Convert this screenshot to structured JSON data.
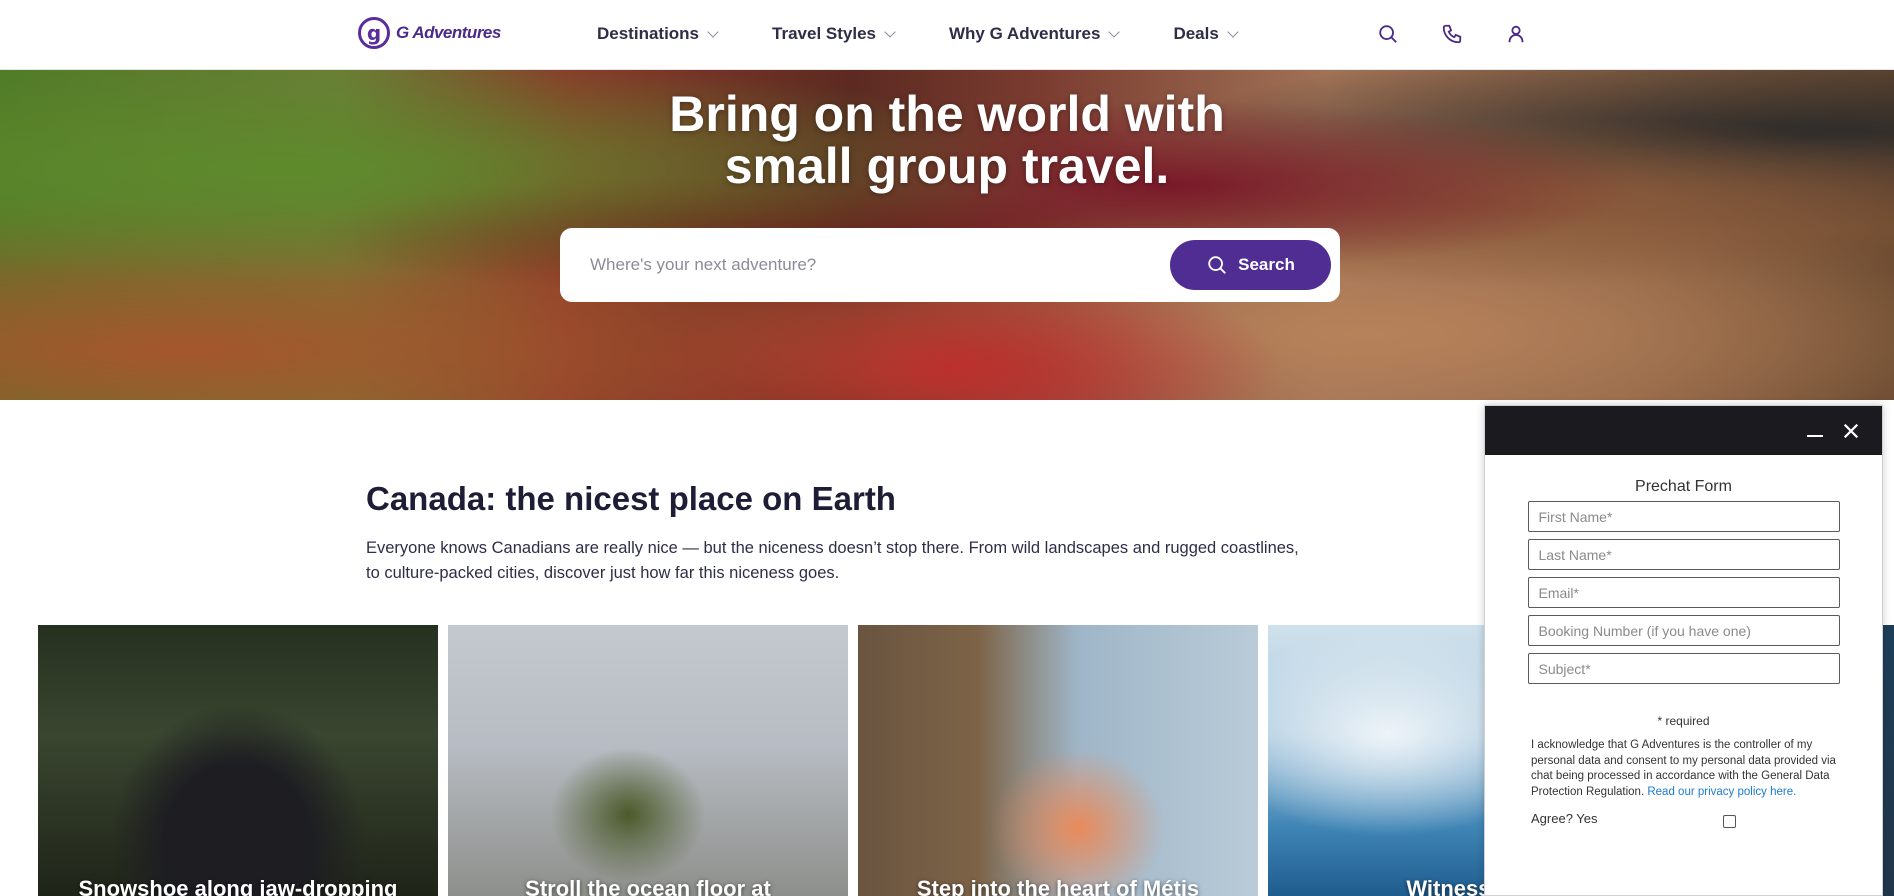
{
  "brand": {
    "logo_text": "G Adventures",
    "accent": "#4f2d93"
  },
  "nav": {
    "menu": [
      {
        "label": "Destinations"
      },
      {
        "label": "Travel Styles"
      },
      {
        "label": "Why G Adventures"
      },
      {
        "label": "Deals"
      }
    ],
    "icons": [
      "search-icon",
      "phone-icon",
      "user-icon"
    ]
  },
  "hero": {
    "title_line1": "Bring on the world with",
    "title_line2": "small group travel.",
    "search_placeholder": "Where's your next adventure?",
    "search_button": "Search"
  },
  "section": {
    "title": "Canada: the nicest place on Earth",
    "body": "Everyone knows Canadians are really nice — but the niceness doesn’t stop there. From wild landscapes and rugged coastlines, to culture-packed cities, discover just how far this niceness goes."
  },
  "cards": [
    {
      "title": "Snowshoe along jaw-dropping"
    },
    {
      "title": "Stroll the ocean floor at"
    },
    {
      "title": "Step into the heart of Métis"
    },
    {
      "title": "Witness the"
    }
  ],
  "chat": {
    "form_title": "Prechat Form",
    "fields": [
      {
        "placeholder": "First Name*"
      },
      {
        "placeholder": "Last Name*"
      },
      {
        "placeholder": "Email*"
      },
      {
        "placeholder": "Booking Number (if you have one)"
      },
      {
        "placeholder": "Subject*"
      }
    ],
    "required_note": "* required",
    "consent_text": "I acknowledge that G Adventures is the controller of my personal data and consent to my personal data provided via chat being processed in accordance with the General Data Protection Regulation.",
    "privacy_link": "Read our privacy policy here.",
    "agree_label": "Agree? Yes"
  }
}
